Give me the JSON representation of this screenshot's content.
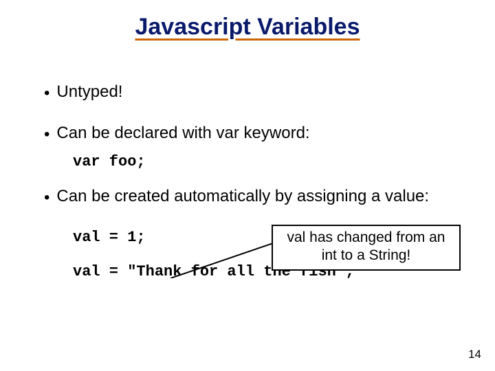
{
  "title": "Javascript Variables",
  "bullets": {
    "b1": "Untyped!",
    "b2": "Can be declared with var keyword:",
    "b3": "Can be created automatically by assigning a value:"
  },
  "code": {
    "c1": "var foo;",
    "c2": "val = 1;",
    "c3": "val = \"Thank for all the fish\";"
  },
  "callout": {
    "line1": "val has changed from an",
    "line2": "int to a String!"
  },
  "page_number": "14"
}
